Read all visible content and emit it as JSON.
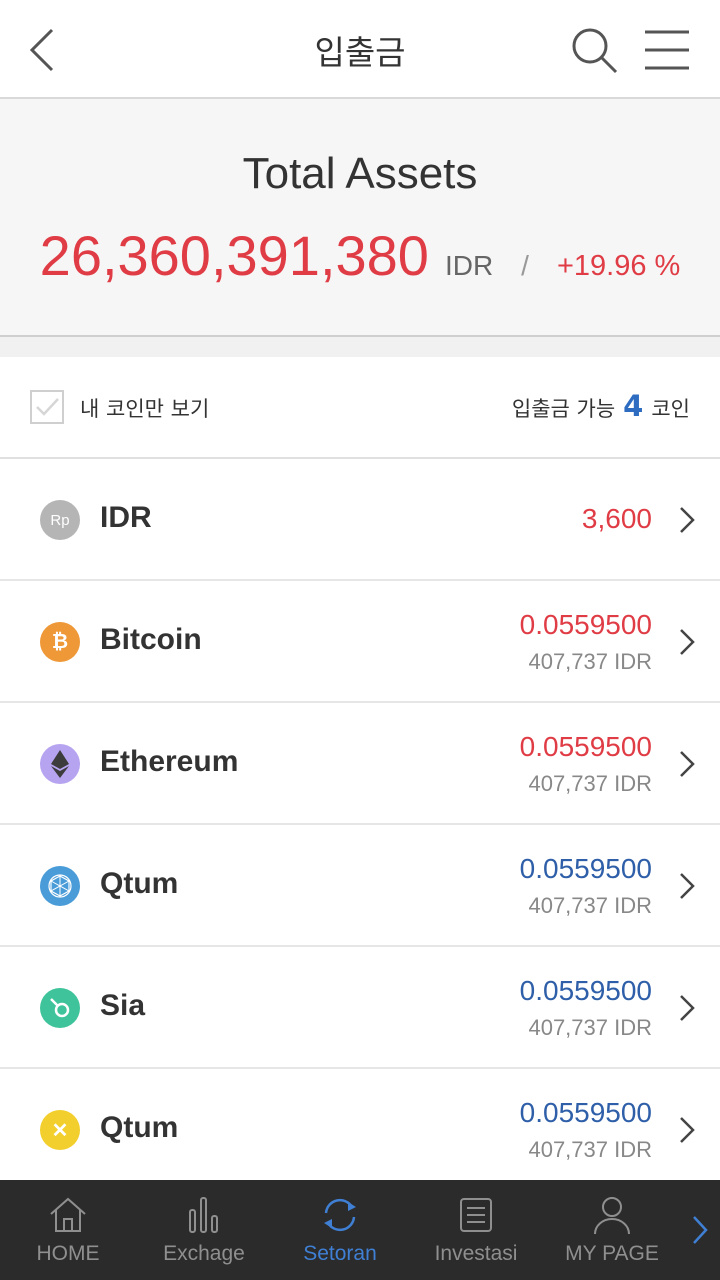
{
  "header": {
    "title": "입출금"
  },
  "summary": {
    "label": "Total Assets",
    "amount": "26,360,391,380",
    "currency": "IDR",
    "separator": "/",
    "rate": "+19.96 %"
  },
  "filter": {
    "checkbox_label": "내 코인만 보기",
    "available_prefix": "입출금 가능",
    "available_count": "4",
    "available_suffix": "코인"
  },
  "coins": [
    {
      "name": "IDR",
      "icon": "rupiah-icon",
      "icon_text": "Rp",
      "icon_color": "#b5b5b5",
      "amount": "3,600",
      "amount_color": "red",
      "sub": ""
    },
    {
      "name": "Bitcoin",
      "icon": "bitcoin-icon",
      "icon_text": "₿",
      "icon_color": "#ee9838",
      "amount": "0.0559500",
      "amount_color": "red",
      "sub": "407,737 IDR"
    },
    {
      "name": "Ethereum",
      "icon": "ethereum-icon",
      "icon_text": "",
      "icon_color": "#b7a4f0",
      "amount": "0.0559500",
      "amount_color": "red",
      "sub": "407,737 IDR"
    },
    {
      "name": "Qtum",
      "icon": "qtum-icon",
      "icon_text": "",
      "icon_color": "#4a9cd8",
      "amount": "0.0559500",
      "amount_color": "blue",
      "sub": "407,737 IDR"
    },
    {
      "name": "Sia",
      "icon": "sia-icon",
      "icon_text": "",
      "icon_color": "#3fc39a",
      "amount": "0.0559500",
      "amount_color": "blue",
      "sub": "407,737 IDR"
    },
    {
      "name": "Qtum",
      "icon": "x-coin-icon",
      "icon_text": "✕",
      "icon_color": "#f2cf2c",
      "amount": "0.0559500",
      "amount_color": "blue",
      "sub": "407,737 IDR"
    }
  ],
  "nav": {
    "home": "HOME",
    "exchange": "Exchage",
    "setoran": "Setoran",
    "investasi": "Investasi",
    "mypage": "MY PAGE"
  },
  "colors": {
    "red": "#e03c45",
    "blue": "#2e5fa8",
    "nav_active": "#3f7fd4",
    "nav_bg": "#2b2b2b"
  }
}
